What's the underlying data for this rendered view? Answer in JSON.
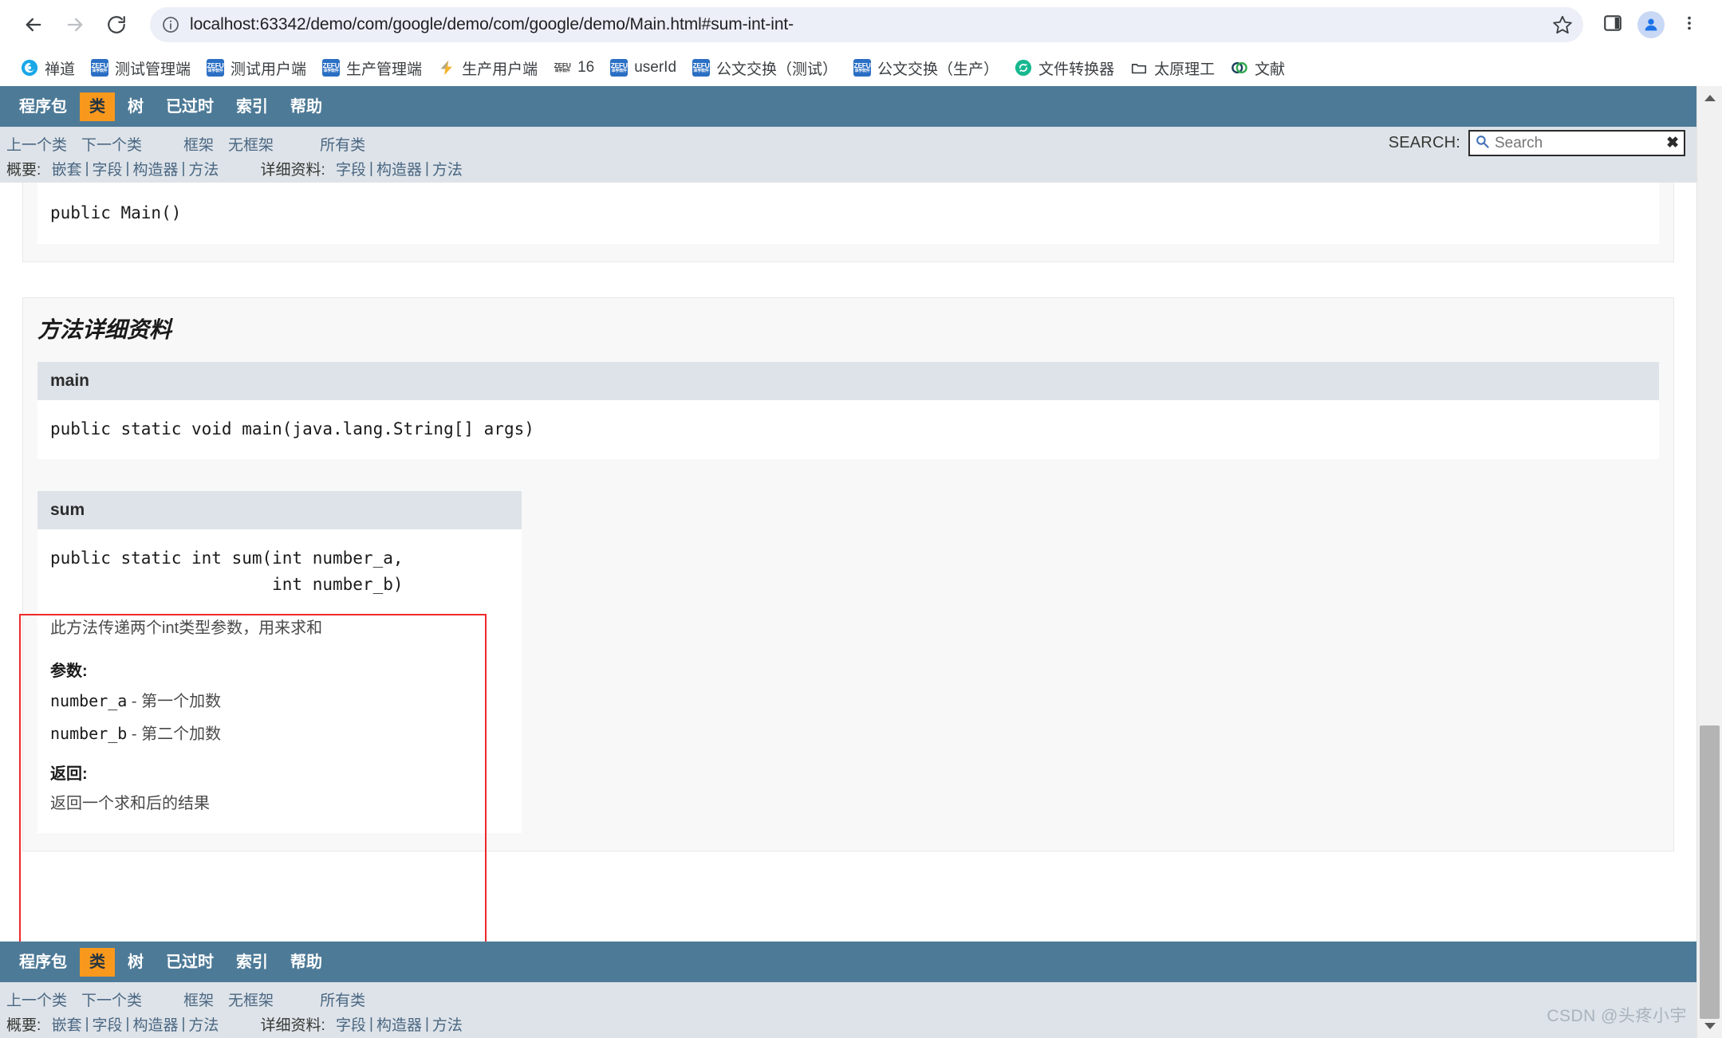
{
  "browser": {
    "back_icon": "back-arrow-icon",
    "forward_icon": "forward-arrow-icon",
    "reload_icon": "reload-icon",
    "site_info_icon": "site-info-icon",
    "url": "localhost:63342/demo/com/google/demo/com/google/demo/Main.html#sum-int-int-",
    "star_icon": "bookmark-star-icon",
    "side_panel_icon": "side-panel-icon",
    "profile_icon": "profile-avatar-icon",
    "menu_icon": "three-dot-menu-icon",
    "bookmarks": [
      {
        "label": "禅道",
        "icon": "zentao-favicon"
      },
      {
        "label": "测试管理端",
        "icon": "zefu-favicon"
      },
      {
        "label": "测试用户端",
        "icon": "zefu-favicon"
      },
      {
        "label": "生产管理端",
        "icon": "zefu-favicon"
      },
      {
        "label": "生产用户端",
        "icon": "lightning-favicon"
      },
      {
        "label": "16",
        "icon": "zefu-plain-favicon"
      },
      {
        "label": "userId",
        "icon": "zefu-favicon"
      },
      {
        "label": "公文交换（测试）",
        "icon": "zefu-favicon"
      },
      {
        "label": "公文交换（生产）",
        "icon": "zefu-favicon"
      },
      {
        "label": "文件转换器",
        "icon": "refresh-circle-favicon"
      },
      {
        "label": "太原理工",
        "icon": "folder-icon"
      },
      {
        "label": "文献",
        "icon": "rings-favicon"
      }
    ]
  },
  "javadoc": {
    "topnav": [
      {
        "label": "程序包",
        "active": false
      },
      {
        "label": "类",
        "active": true
      },
      {
        "label": "树",
        "active": false
      },
      {
        "label": "已过时",
        "active": false
      },
      {
        "label": "索引",
        "active": false
      },
      {
        "label": "帮助",
        "active": false
      }
    ],
    "subnav": {
      "prev_class": "上一个类",
      "next_class": "下一个类",
      "frames": "框架",
      "no_frames": "无框架",
      "all_classes": "所有类",
      "summary_label": "概要:",
      "summary_items": [
        "嵌套",
        "字段",
        "构造器",
        "方法"
      ],
      "detail_label": "详细资料:",
      "detail_items": [
        "字段",
        "构造器",
        "方法"
      ]
    },
    "search": {
      "label": "SEARCH:",
      "placeholder": "Search",
      "value": "",
      "search_icon": "search-magnifier-icon",
      "reset_icon": "clear-search-icon"
    },
    "constructor_block": {
      "signature": "public Main()"
    },
    "method_detail": {
      "title": "方法详细资料",
      "members": [
        {
          "name": "main",
          "signature": "public static void main(java.lang.String[] args)",
          "description": "",
          "params_label": "",
          "params": [],
          "returns_label": "",
          "returns": ""
        },
        {
          "name": "sum",
          "signature": "public static int sum(int number_a,\n                      int number_b)",
          "description": "此方法传递两个int类型参数，用来求和",
          "params_label": "参数:",
          "params": [
            {
              "name": "number_a",
              "sep": " - ",
              "desc": "第一个加数"
            },
            {
              "name": "number_b",
              "sep": " - ",
              "desc": "第二个加数"
            }
          ],
          "returns_label": "返回:",
          "returns": "返回一个求和后的结果"
        }
      ]
    }
  },
  "watermark": "CSDN @头疼小宇",
  "colors": {
    "nav_bg": "#4d7a97",
    "nav_active": "#f8981d",
    "subnav_bg": "#dee3e9",
    "link": "#4a6782",
    "highlight": "#ef2929"
  }
}
